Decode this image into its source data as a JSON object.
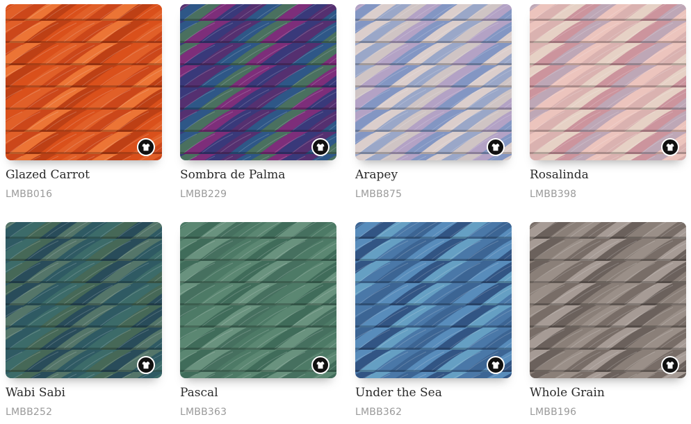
{
  "products": [
    {
      "name": "Glazed Carrot",
      "code": "LMBB016",
      "palette": [
        "#d9501b",
        "#e2612a",
        "#c9451a",
        "#ee7a3a",
        "#b83d14"
      ]
    },
    {
      "name": "Sombra de Palma",
      "code": "LMBB229",
      "palette": [
        "#3a3a7a",
        "#5a2f6e",
        "#2d5d8a",
        "#4e7a5a",
        "#8a2d7a"
      ]
    },
    {
      "name": "Arapey",
      "code": "LMBB875",
      "palette": [
        "#9aa7c8",
        "#d8c9c3",
        "#b7a1c4",
        "#7f93c2",
        "#e6d5cc"
      ]
    },
    {
      "name": "Rosalinda",
      "code": "LMBB398",
      "palette": [
        "#d9b2b0",
        "#e8d6c9",
        "#c98e9a",
        "#b9a4b7",
        "#eec7c0"
      ]
    },
    {
      "name": "Wabi Sabi",
      "code": "LMBB252",
      "palette": [
        "#2f5a63",
        "#3e6e6a",
        "#4a6b55",
        "#284a58",
        "#5a7a6a"
      ]
    },
    {
      "name": "Pascal",
      "code": "LMBB363",
      "palette": [
        "#4d7a66",
        "#5e8a74",
        "#3e6a58",
        "#6e9682",
        "#456e5e"
      ]
    },
    {
      "name": "Under the Sea",
      "code": "LMBB362",
      "palette": [
        "#4a78a8",
        "#3a6290",
        "#5a8fbe",
        "#2e4f7e",
        "#6aa6c8"
      ]
    },
    {
      "name": "Whole Grain",
      "code": "LMBB196",
      "palette": [
        "#8a7f78",
        "#9c928b",
        "#746a64",
        "#aaa09a",
        "#655c57"
      ]
    }
  ],
  "icons": {
    "shirt": "shirt-icon"
  }
}
